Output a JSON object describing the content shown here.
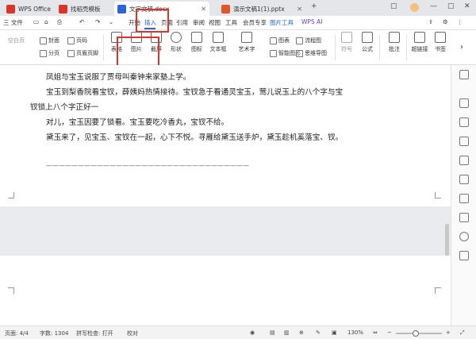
{
  "tabs": [
    {
      "label": "WPS Office",
      "color": "#d9352b"
    },
    {
      "label": "找稻壳模板",
      "color": "#d9352b"
    },
    {
      "label": "文字文稿.docx",
      "color": "#2b65d9"
    },
    {
      "label": "演示文稿1(1).pptx",
      "color": "#e0562b"
    }
  ],
  "menu": {
    "file": "三 文件",
    "items": [
      "开始",
      "插入",
      "页面",
      "引用",
      "审阅",
      "视图",
      "工具",
      "会员专享",
      "图片工具"
    ],
    "wps_ai": "WPS AI"
  },
  "ribbon": {
    "cover": "封面",
    "page_num": "页码",
    "blank_page": "空白页",
    "section": "分页",
    "header_footer": "页眉页脚",
    "table": "表格",
    "image": "图片",
    "screenshot": "截屏",
    "shape": "形状",
    "icon": "图标",
    "textbox": "文本框",
    "art_text": "艺术字",
    "chart": "图表",
    "smart_graphic": "智能图形",
    "flowchart": "流程图",
    "mindmap": "思维导图",
    "symbol": "符号",
    "formula": "公式",
    "comment": "批注",
    "hyperlink": "超链接",
    "bookmark": "书签"
  },
  "document": {
    "line1": "凤姐与宝玉说服了贾母叫秦钟来家塾上学。",
    "line2": "宝玉到梨香院看宝钗，薛姨妈热情接待。宝钗急于看通灵宝玉，莺儿说玉上的八个字与宝钗锁上八个字正好一",
    "line3": "对儿，宝玉因要了锁看。宝玉要吃冷香丸，宝钗不给。",
    "line4": "黛玉来了，见宝玉、宝钗在一起，心下不悦。寻雁给黛玉送手炉，黛玉趁机奚落宝、钗。",
    "rule": "————————————————————————————————"
  },
  "status": {
    "page": "页面: 4/4",
    "words": "字数: 1304",
    "spellcheck": "拼写检查: 打开",
    "proofread": "校对",
    "zoom": "130%"
  },
  "icons": {
    "close": "close-icon",
    "settings": "gear-icon"
  }
}
